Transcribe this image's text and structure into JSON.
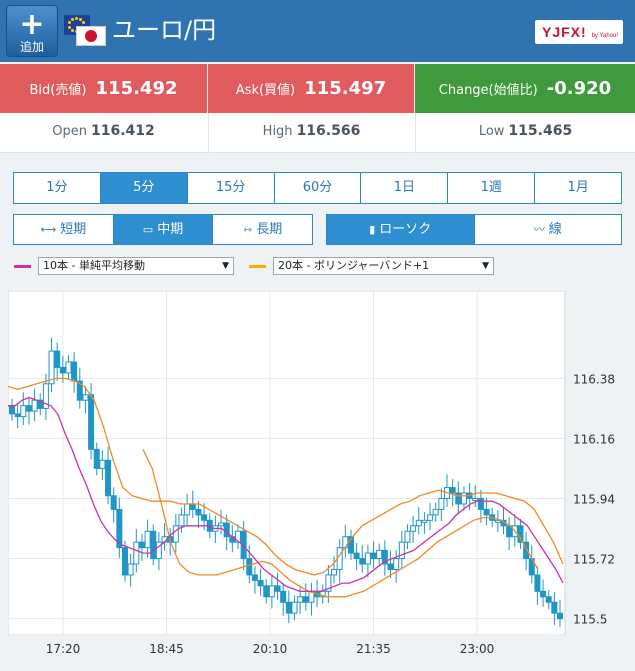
{
  "header": {
    "add_label": "追加",
    "pair_name": "ユーロ/円",
    "logo_text": "YJFX!",
    "logo_sub": "by Yahoo!"
  },
  "quote": {
    "bid_label": "Bid(売値)",
    "bid_value": "115.492",
    "ask_label": "Ask(買値)",
    "ask_value": "115.497",
    "change_label": "Change(始値比)",
    "change_value": "-0.920"
  },
  "stats": {
    "open_label": "Open",
    "open_value": "116.412",
    "high_label": "High",
    "high_value": "116.566",
    "low_label": "Low",
    "low_value": "115.465"
  },
  "timeframes": [
    "1分",
    "5分",
    "15分",
    "60分",
    "1日",
    "1週",
    "1月"
  ],
  "timeframe_selected": "5分",
  "ranges": [
    {
      "label": "短期",
      "icon": "range-short-icon"
    },
    {
      "label": "中期",
      "icon": "range-mid-icon"
    },
    {
      "label": "長期",
      "icon": "range-long-icon"
    }
  ],
  "range_selected": "中期",
  "chart_types": [
    {
      "label": "ローソク",
      "icon": "candlestick-icon"
    },
    {
      "label": "線",
      "icon": "line-chart-icon"
    }
  ],
  "chart_type_selected": "ローソク",
  "indicators": [
    {
      "label": "10本 - 単純平均移動",
      "color": "#cc33aa"
    },
    {
      "label": "20本 - ボリンジャーバンド+1",
      "color": "#f0b400"
    }
  ],
  "colors": {
    "header": "#2f73b0",
    "bid_ask": "#e05b5d",
    "change": "#3e9a3c",
    "candle": "#1f96c8",
    "sma": "#cc33aa",
    "bollinger": "#f08a24"
  },
  "chart_data": {
    "type": "candlestick",
    "x_tick_labels": [
      "17:20",
      "18:45",
      "20:10",
      "21:35",
      "23:00"
    ],
    "y_tick_labels": [
      "116.38",
      "116.16",
      "115.94",
      "115.72",
      "115.5"
    ],
    "y_ticks": [
      116.38,
      116.16,
      115.94,
      115.72,
      115.5
    ],
    "ylim": [
      115.44,
      116.7
    ],
    "grid": true,
    "series": [
      {
        "name": "ローソク",
        "close": [
          116.25,
          116.24,
          116.28,
          116.26,
          116.3,
          116.27,
          116.36,
          116.48,
          116.42,
          116.4,
          116.44,
          116.37,
          116.3,
          116.32,
          116.12,
          116.05,
          116.08,
          115.95,
          115.9,
          115.76,
          115.66,
          115.7,
          115.78,
          115.76,
          115.82,
          115.72,
          115.78,
          115.8,
          115.78,
          115.84,
          115.88,
          115.92,
          115.9,
          115.88,
          115.86,
          115.82,
          115.84,
          115.85,
          115.8,
          115.78,
          115.82,
          115.72,
          115.66,
          115.64,
          115.62,
          115.58,
          115.62,
          115.6,
          115.56,
          115.52,
          115.56,
          115.58,
          115.56,
          115.6,
          115.58,
          115.6,
          115.66,
          115.68,
          115.76,
          115.8,
          115.74,
          115.72,
          115.7,
          115.74,
          115.72,
          115.75,
          115.7,
          115.68,
          115.72,
          115.78,
          115.82,
          115.84,
          115.86,
          115.86,
          115.88,
          115.9,
          115.94,
          115.98,
          115.96,
          115.92,
          115.96,
          115.94,
          115.94,
          115.9,
          115.88,
          115.86,
          115.86,
          115.84,
          115.8,
          115.84,
          115.78,
          115.72,
          115.66,
          115.6,
          115.58,
          115.56,
          115.52,
          115.5
        ]
      }
    ],
    "sma": [
      116.28,
      116.28,
      116.3,
      116.31,
      116.3,
      116.29,
      116.28,
      116.25,
      116.18,
      116.12,
      116.05,
      115.99,
      115.92,
      115.86,
      115.82,
      115.79,
      115.77,
      115.76,
      115.75,
      115.74,
      115.74,
      115.76,
      115.78,
      115.81,
      115.83,
      115.84,
      115.84,
      115.84,
      115.84,
      115.83,
      115.83,
      115.81,
      115.79,
      115.77,
      115.74,
      115.71,
      115.68,
      115.66,
      115.64,
      115.62,
      115.61,
      115.6,
      115.6,
      115.6,
      115.6,
      115.61,
      115.62,
      115.63,
      115.63,
      115.64,
      115.65,
      115.67,
      115.69,
      115.71,
      115.72,
      115.73,
      115.74,
      115.75,
      115.77,
      115.79,
      115.81,
      115.83,
      115.85,
      115.88,
      115.9,
      115.92,
      115.93,
      115.93,
      115.93,
      115.92,
      115.9,
      115.88,
      115.86,
      115.84,
      115.8,
      115.76,
      115.72,
      115.68,
      115.63
    ],
    "bollinger_upper": [
      116.35,
      116.34,
      116.35,
      116.36,
      116.37,
      116.38,
      116.38,
      116.37,
      116.35,
      116.3,
      116.2,
      116.08,
      115.98,
      115.95,
      115.94,
      115.93,
      115.93,
      115.93,
      115.92,
      115.92,
      115.92,
      115.9,
      115.88,
      115.86,
      115.84,
      115.82,
      115.8,
      115.77,
      115.73,
      115.7,
      115.68,
      115.67,
      115.66,
      115.67,
      115.7,
      115.75,
      115.8,
      115.84,
      115.86,
      115.88,
      115.9,
      115.92,
      115.93,
      115.95,
      115.96,
      115.97,
      115.96,
      115.95,
      115.95,
      115.96,
      115.96,
      115.96,
      115.95,
      115.94,
      115.93,
      115.9,
      115.84,
      115.78,
      115.7
    ],
    "bollinger_lower": [
      116.12,
      116.05,
      115.92,
      115.78,
      115.7,
      115.67,
      115.66,
      115.66,
      115.66,
      115.67,
      115.68,
      115.69,
      115.7,
      115.71,
      115.7,
      115.67,
      115.64,
      115.62,
      115.6,
      115.59,
      115.58,
      115.58,
      115.58,
      115.59,
      115.6,
      115.62,
      115.64,
      115.66,
      115.68,
      115.7,
      115.72,
      115.75,
      115.78,
      115.8,
      115.82,
      115.84,
      115.86,
      115.87,
      115.87,
      115.86,
      115.84,
      115.8,
      115.74,
      115.68
    ]
  }
}
